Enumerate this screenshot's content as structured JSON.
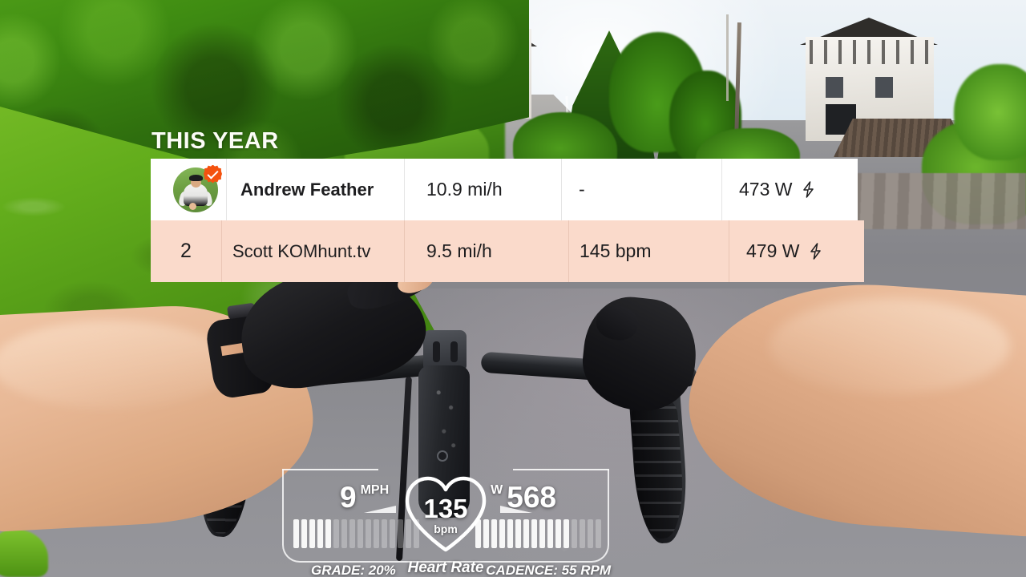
{
  "overlay": {
    "section_title": "THIS YEAR"
  },
  "leaderboard": {
    "rows": [
      {
        "rank": "",
        "name": "Andrew Feather",
        "avatar_icon": "cyclist-avatar",
        "verified_icon": "verified-badge-icon",
        "speed": "10.9 mi/h",
        "heart_rate": "-",
        "power": "473 W",
        "power_icon": "lightning-bolt-icon",
        "highlight_color": "#ffffff"
      },
      {
        "rank": "2",
        "name": "Scott KOMhunt.tv",
        "speed": "9.5 mi/h",
        "heart_rate": "145 bpm",
        "power": "479 W",
        "power_icon": "lightning-bolt-icon",
        "highlight_color": "#fadacb"
      }
    ]
  },
  "hud": {
    "speed_value": "9",
    "speed_unit": "MPH",
    "power_value": "568",
    "power_unit": "W",
    "heart_rate_value": "135",
    "heart_rate_unit": "bpm",
    "heart_rate_label": "Heart Rate",
    "grade_text": "GRADE: 20%",
    "cadence_text": "CADENCE: 55 RPM",
    "speed_bars_total": 16,
    "speed_bars_filled": 5,
    "power_bars_total": 16,
    "power_bars_filled": 12,
    "accent_color": "#ffffff"
  }
}
